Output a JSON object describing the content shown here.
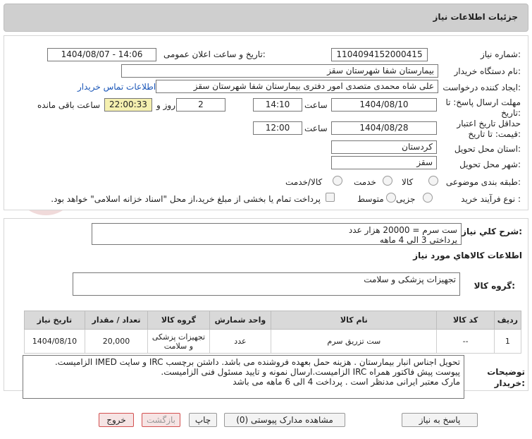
{
  "header": {
    "title": "جزئیات اطلاعات نیاز"
  },
  "watermark": "AriaTender.neT",
  "form": {
    "need_number_label": "شماره نیاز:",
    "need_number": "1104094152000415",
    "announce_label": "تاریخ و ساعت اعلان عمومی:",
    "announce_value": "1404/08/07 - 14:06",
    "buyer_label": "نام دستگاه خریدار:",
    "buyer_value": "بیمارستان شفا شهرستان سقز",
    "creator_label": "ایجاد کننده درخواست:",
    "creator_value": "علی شاه محمدی متصدی امور دفتری بیمارستان شفا شهرستان سقز",
    "contact_link": "اطلاعات تماس خریدار",
    "deadline_label_1": "مهلت ارسال پاسخ: تا",
    "deadline_label_2": "تاریخ:",
    "deadline_date": "1404/08/10",
    "time_label": "ساعت",
    "deadline_time": "14:10",
    "days_value": "2",
    "days_label": "روز و",
    "remaining_time": "22:00:33",
    "remaining_label": "ساعت باقی مانده",
    "min_validity_label_1": "حداقل تاریخ اعتبار",
    "min_validity_label_2": "قیمت: تا تاریخ:",
    "validity_date": "1404/08/28",
    "validity_time": "12:00",
    "province_label": "استان محل تحویل:",
    "province_value": "کردستان",
    "city_label": "شهر محل تحویل:",
    "city_value": "سقز",
    "category_label": "طبقه بندی موضوعی:",
    "category_options": [
      "کالا",
      "خدمت",
      "کالا/خدمت"
    ],
    "process_label": "نوع فرآیند خرید :",
    "process_options": [
      "جزیی",
      "متوسط"
    ],
    "payment_note": "پرداخت تمام یا بخشی از مبلغ خرید،از محل \"اسناد خزانه اسلامی\" خواهد بود."
  },
  "summary": {
    "label": "شرح کلي نياز:",
    "text": "ست سرم = 20000 هزار عدد\nپرداختی 3 الی 4 ماهه"
  },
  "goods": {
    "section_title": "اطلاعات کالاهاي مورد نياز",
    "group_label": "گروه کالا:",
    "group_value": "تجهیزات پزشکی و سلامت",
    "columns": [
      "رديف",
      "کد کالا",
      "نام کالا",
      "واحد شمارش",
      "گروه کالا",
      "تعداد / مقدار",
      "تاریخ نیاز"
    ],
    "rows": [
      [
        "1",
        "--",
        "ست تزریق سرم",
        "عدد",
        "تجهیزات پزشکی و سلامت",
        "20,000",
        "1404/08/10"
      ]
    ]
  },
  "buyer_notes": {
    "label_1": "توضیحات",
    "label_2": "خریدار:",
    "text": "تحویل اجناس  انبار بیمارستان . هزینه حمل بعهده فروشنده می باشد.  داشتن برچسب IRC  و سایت  IMED  الزامیست.\nپیوست پیش فاکتور همراه IRC  الزامیست.ارسال نمونه و تایید مسئول فنی الزامیست.\n مارک معتبر ایرانی مدنظر است . پرداخت 4 الی 6 ماهه می باشد"
  },
  "buttons": {
    "reply": "پاسخ به نیاز",
    "attachments": "مشاهده مدارک پیوستی (0)",
    "print": "چاپ",
    "back": "بازگشت",
    "exit": "خروج"
  }
}
